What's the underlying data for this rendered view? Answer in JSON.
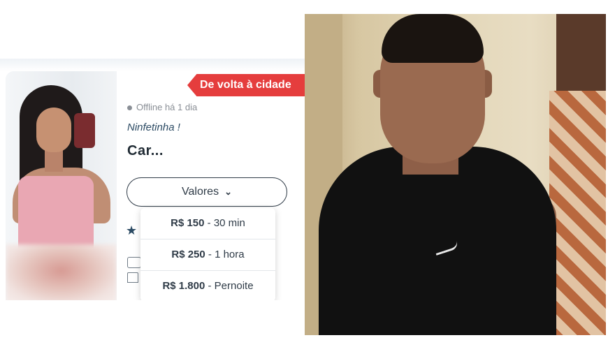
{
  "listing": {
    "badge": "De volta à cidade",
    "status": "Offline há 1 dia",
    "tagline": "Ninfetinha !",
    "title": "Car...",
    "valores_button": "Valores",
    "prices": [
      {
        "amount": "R$ 150",
        "duration": " - 30 min"
      },
      {
        "amount": "R$ 250",
        "duration": " - 1 hora"
      },
      {
        "amount": "R$ 1.800",
        "duration": " - Pernoite"
      }
    ],
    "icons": {
      "status": "status-dot",
      "chevron": "chevron-down-icon",
      "star": "star-icon"
    },
    "colors": {
      "badge_bg": "#e53d3d",
      "text_dark": "#2f3b47",
      "tagline": "#2b4a63"
    }
  },
  "photos": {
    "left": "listing-profile-photo",
    "right": "man-selfie-photo"
  }
}
